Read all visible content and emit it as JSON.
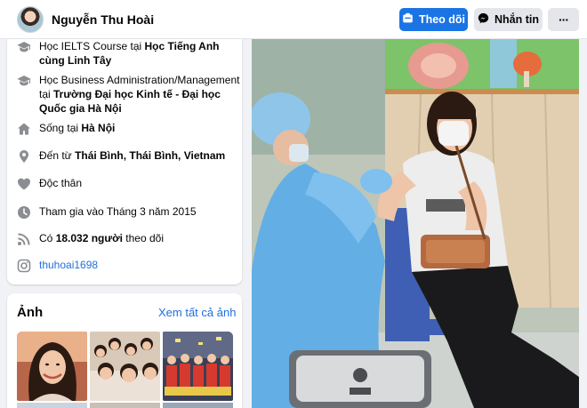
{
  "header": {
    "name": "Nguyễn Thu Hoài",
    "follow_label": "Theo dõi",
    "message_label": "Nhắn tin",
    "more_label": "···"
  },
  "intro": {
    "study1": {
      "prefix": "Học IELTS Course tại ",
      "place": "Học Tiếng Anh cùng Linh Tây"
    },
    "study2": {
      "prefix": "Học Business Administration/Management tại ",
      "place": "Trường Đại học Kinh tế - Đại học Quốc gia Hà Nội"
    },
    "lives": {
      "prefix": "Sống tại ",
      "place": "Hà Nội"
    },
    "from": {
      "prefix": "Đến từ ",
      "place": "Thái Bình, Thái Bình, Vietnam"
    },
    "relationship": "Độc thân",
    "joined": "Tham gia vào Tháng 3 năm 2015",
    "followers": {
      "prefix": "Có ",
      "count": "18.032 người",
      "suffix": " theo dõi"
    },
    "instagram": "thuhoai1698"
  },
  "photos": {
    "title": "Ảnh",
    "see_all": "Xem tất cả ảnh"
  },
  "icons": {
    "follow": "follow-icon",
    "messenger": "messenger-icon",
    "study": "graduation-cap-icon",
    "home": "home-icon",
    "location": "location-pin-icon",
    "heart": "heart-icon",
    "clock": "clock-icon",
    "rss": "rss-icon",
    "instagram": "instagram-icon"
  },
  "colors": {
    "accent": "#1b74e4",
    "link": "#216fdb",
    "icon_gray": "#8a8d91",
    "page_bg": "#f0f2f5"
  }
}
